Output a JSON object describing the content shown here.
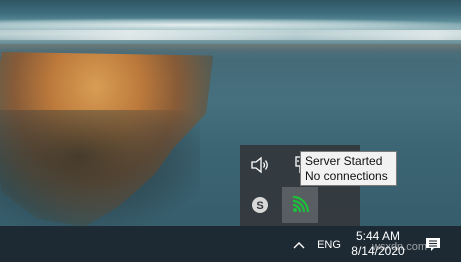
{
  "tooltip": {
    "line1": "Server Started",
    "line2": "No connections"
  },
  "taskbar": {
    "language": "ENG",
    "time": "5:44 AM",
    "date": "8/14/2020"
  },
  "watermark": "wsxdn.com",
  "icons": {
    "speaker": "speaker-icon",
    "usb": "usb-device-icon",
    "skype": "skype-icon",
    "server": "wifi-server-icon",
    "chevron": "chevron-up-icon",
    "notifications": "action-center-icon"
  },
  "colors": {
    "server_icon": "#1dbf3a",
    "taskbar": "#1e2a33",
    "tray_bg": "#34383c"
  }
}
